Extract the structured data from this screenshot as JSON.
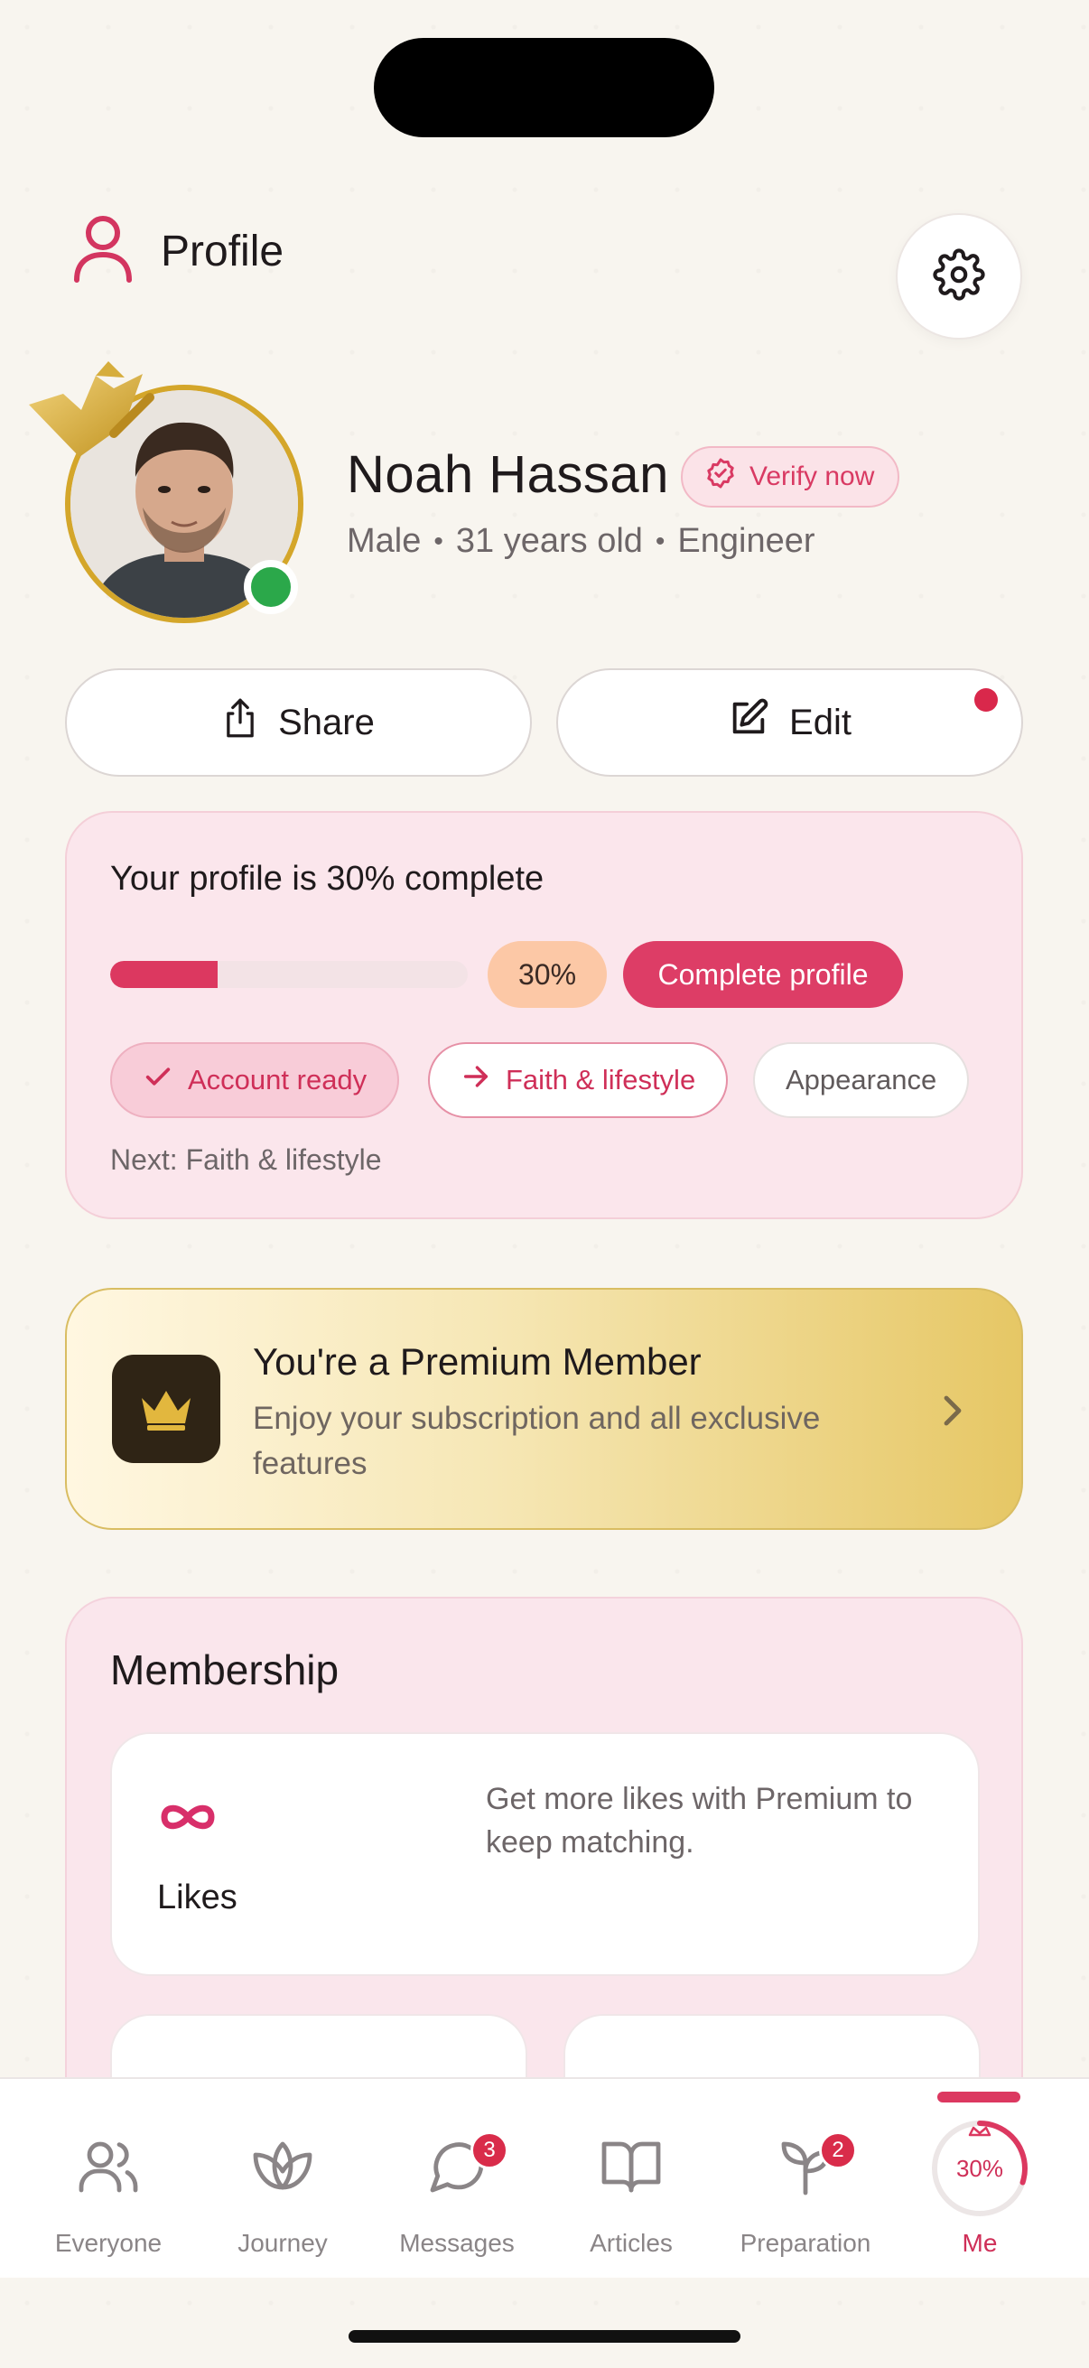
{
  "header": {
    "title": "Profile",
    "icon": "person-icon",
    "settings_icon": "gear-icon"
  },
  "profile": {
    "name": "Noah Hassan",
    "verify_label": "Verify now",
    "gender": "Male",
    "age": "31 years old",
    "occupation": "Engineer",
    "online": true
  },
  "actions": {
    "share_label": "Share",
    "edit_label": "Edit"
  },
  "progress": {
    "title": "Your profile is 30% complete",
    "percent": 30,
    "percent_label": "30%",
    "complete_button": "Complete profile",
    "steps": [
      {
        "label": "Account ready",
        "state": "done"
      },
      {
        "label": "Faith & lifestyle",
        "state": "next"
      },
      {
        "label": "Appearance",
        "state": "todo"
      }
    ],
    "next_text": "Next: Faith & lifestyle"
  },
  "premium": {
    "title": "You're a Premium Member",
    "subtitle": "Enjoy your subscription and all exclusive features"
  },
  "membership": {
    "title": "Membership",
    "likes": {
      "label": "Likes",
      "description": "Get more likes with Premium to keep matching."
    }
  },
  "tabbar": {
    "tabs": [
      {
        "label": "Everyone",
        "icon": "people-icon"
      },
      {
        "label": "Journey",
        "icon": "leaf-icon"
      },
      {
        "label": "Messages",
        "icon": "chat-icon",
        "badge": "3"
      },
      {
        "label": "Articles",
        "icon": "book-icon"
      },
      {
        "label": "Preparation",
        "icon": "sprout-icon",
        "badge": "2"
      },
      {
        "label": "Me",
        "icon": "profile-ring-icon",
        "progress_label": "30%",
        "active": true
      }
    ]
  },
  "colors": {
    "accent": "#dc3860",
    "gold": "#d4a62a",
    "online": "#2ba84a"
  }
}
